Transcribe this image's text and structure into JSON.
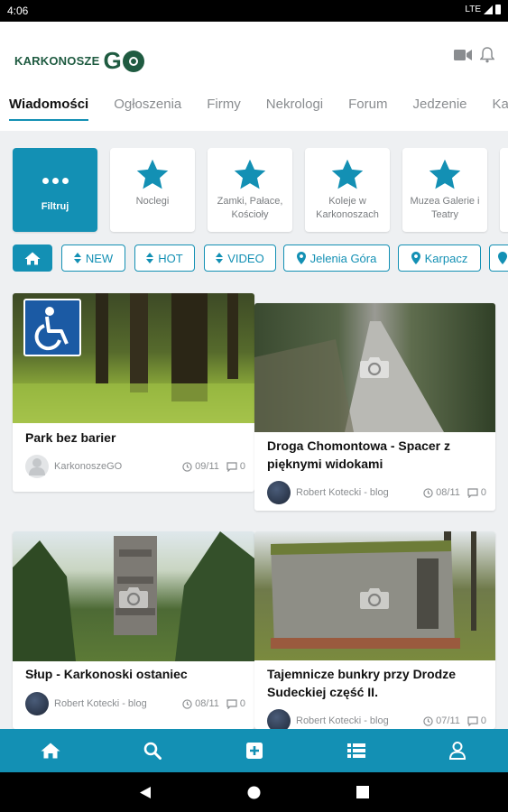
{
  "status_bar": {
    "time": "4:06",
    "network": "LTE"
  },
  "brand": {
    "name": "KARKONOSZE",
    "go": "G"
  },
  "tabs": [
    {
      "label": "Wiadomości",
      "active": true
    },
    {
      "label": "Ogłoszenia"
    },
    {
      "label": "Firmy"
    },
    {
      "label": "Nekrologi"
    },
    {
      "label": "Forum"
    },
    {
      "label": "Jedzenie"
    },
    {
      "label": "Ka"
    }
  ],
  "filters": {
    "primary_label": "Filtruj",
    "categories": [
      "Noclegi",
      "Zamki, Pałace, Kościoły",
      "Koleje w Karkonoszach",
      "Muzea Galerie i Teatry"
    ]
  },
  "chips": {
    "new": "NEW",
    "hot": "HOT",
    "video": "VIDEO",
    "city1": "Jelenia Góra",
    "city2": "Karpacz"
  },
  "articles": [
    {
      "title": "Park bez barier",
      "author": "KarkonoszeGO",
      "date": "09/11",
      "comments": "0"
    },
    {
      "title": "Droga Chomontowa - Spacer z pięknymi widokami",
      "author": "Robert Kotecki - blog",
      "date": "08/11",
      "comments": "0"
    },
    {
      "title": "Słup - Karkonoski ostaniec",
      "author": "Robert Kotecki - blog",
      "date": "08/11",
      "comments": "0"
    },
    {
      "title": "Tajemnicze bunkry przy Drodze Sudeckiej część II.",
      "author": "Robert Kotecki - blog",
      "date": "07/11",
      "comments": "0"
    }
  ],
  "colors": {
    "accent": "#1390b4",
    "brand": "#1f5b41",
    "background": "#eef0f2"
  },
  "icons": [
    "video-icon",
    "bell-icon",
    "star-icon",
    "home-icon",
    "search-icon",
    "add-icon",
    "list-icon",
    "user-icon",
    "camera-icon",
    "wheelchair-icon",
    "clock-icon",
    "comment-icon",
    "location-icon",
    "sort-icon"
  ]
}
